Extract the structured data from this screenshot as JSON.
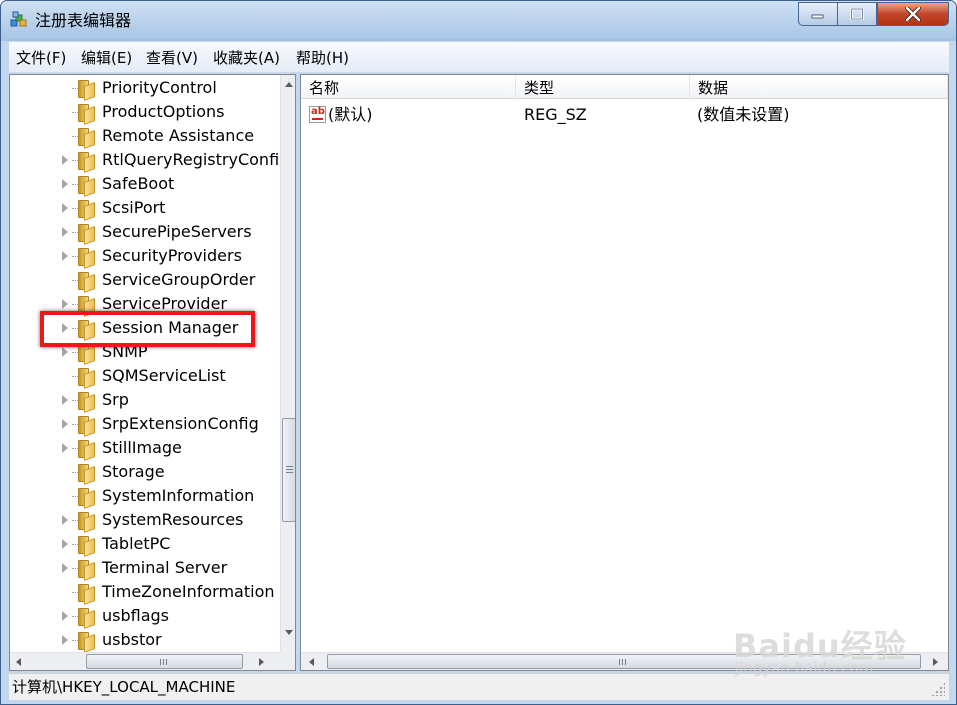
{
  "window": {
    "title": "注册表编辑器",
    "controls": {
      "minimize": "minimize",
      "maximize": "maximize",
      "close": "close"
    }
  },
  "menu": [
    "文件(F)",
    "编辑(E)",
    "查看(V)",
    "收藏夹(A)",
    "帮助(H)"
  ],
  "tree": {
    "items": [
      {
        "label": "PriorityControl",
        "expandable": false
      },
      {
        "label": "ProductOptions",
        "expandable": false
      },
      {
        "label": "Remote Assistance",
        "expandable": false
      },
      {
        "label": "RtlQueryRegistryConfig",
        "expandable": true
      },
      {
        "label": "SafeBoot",
        "expandable": true
      },
      {
        "label": "ScsiPort",
        "expandable": true
      },
      {
        "label": "SecurePipeServers",
        "expandable": true
      },
      {
        "label": "SecurityProviders",
        "expandable": true
      },
      {
        "label": "ServiceGroupOrder",
        "expandable": false
      },
      {
        "label": "ServiceProvider",
        "expandable": true
      },
      {
        "label": "Session Manager",
        "expandable": true,
        "highlighted": true
      },
      {
        "label": "SNMP",
        "expandable": true
      },
      {
        "label": "SQMServiceList",
        "expandable": false
      },
      {
        "label": "Srp",
        "expandable": true
      },
      {
        "label": "SrpExtensionConfig",
        "expandable": true
      },
      {
        "label": "StillImage",
        "expandable": true
      },
      {
        "label": "Storage",
        "expandable": false
      },
      {
        "label": "SystemInformation",
        "expandable": false
      },
      {
        "label": "SystemResources",
        "expandable": true
      },
      {
        "label": "TabletPC",
        "expandable": true
      },
      {
        "label": "Terminal Server",
        "expandable": true
      },
      {
        "label": "TimeZoneInformation",
        "expandable": false
      },
      {
        "label": "usbflags",
        "expandable": true
      },
      {
        "label": "usbstor",
        "expandable": true
      }
    ],
    "highlight_color": "#e8191a"
  },
  "list": {
    "columns": [
      "名称",
      "类型",
      "数据"
    ],
    "rows": [
      {
        "icon": "string-value-icon",
        "icon_text": "ab",
        "name": "(默认)",
        "type": "REG_SZ",
        "data": "(数值未设置)"
      }
    ]
  },
  "status": {
    "path": "计算机\\HKEY_LOCAL_MACHINE"
  },
  "watermark": {
    "logo": "Baidu经验",
    "url": "jingyan.baidu.com"
  }
}
